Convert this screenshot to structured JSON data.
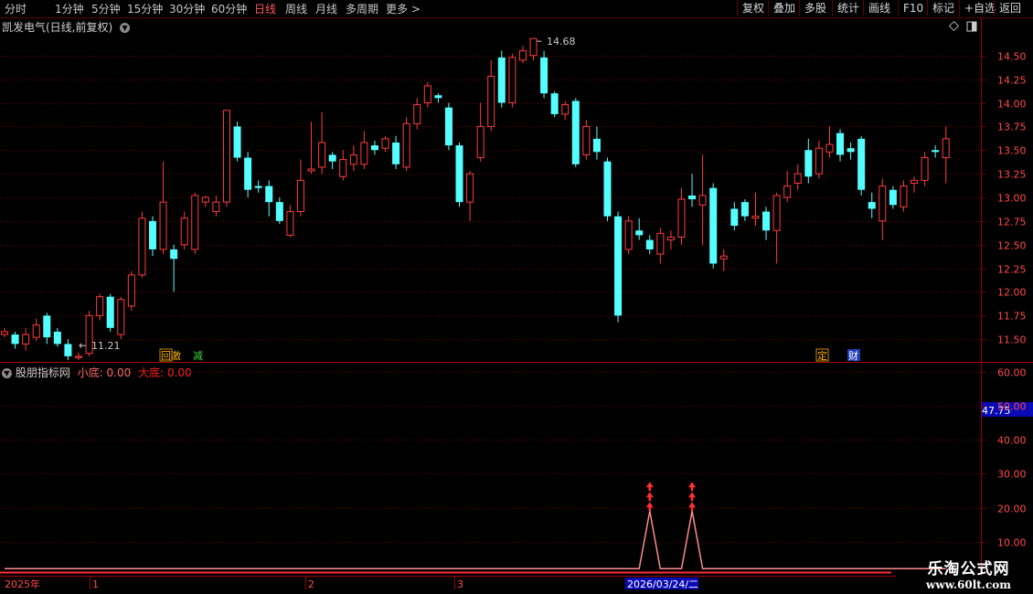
{
  "toolbar": {
    "periods": [
      "分时",
      "1分钟",
      "5分钟",
      "15分钟",
      "30分钟",
      "60分钟",
      "日线",
      "周线",
      "月线",
      "多周期",
      "更多 >"
    ],
    "active_period": "日线",
    "tools": [
      "复权",
      "叠加",
      "多股",
      "统计",
      "画线",
      "F10",
      "标记",
      "+自选",
      "返回"
    ]
  },
  "stock": {
    "title": "凯发电气(日线,前复权)"
  },
  "indicator": {
    "name": "股朋指标网",
    "small_label": "小底: ",
    "small_value": "0.00",
    "big_label": "大底: ",
    "big_value": "0.00",
    "current_readout": "47.75"
  },
  "price_labels": {
    "high": "14.68",
    "low": "11.21"
  },
  "event_tags": [
    "回",
    "激",
    "减",
    "定",
    "财"
  ],
  "time_axis": {
    "labels": [
      "2025年",
      "1",
      "2",
      "3"
    ],
    "cursor_date": "2026/03/24/二"
  },
  "watermark": {
    "site": "乐淘公式网",
    "url": "www.60lt.com"
  },
  "colors": {
    "up": "#ff3c3c",
    "down": "#54ffff",
    "grid": "#7a0000",
    "axis_text": "#ff4a4a",
    "signal": "#ff3030"
  },
  "chart_data": [
    {
      "type": "candlestick",
      "title": "凯发电气(日线,前复权)",
      "y_ticks": [
        "14.50",
        "14.25",
        "14.00",
        "13.75",
        "13.50",
        "13.25",
        "13.00",
        "12.75",
        "12.50",
        "12.25",
        "12.00",
        "11.75",
        "11.50"
      ],
      "ylim": [
        11.28,
        14.72
      ],
      "grid": true,
      "candles": [
        [
          11.55,
          11.58,
          11.52,
          11.62
        ],
        [
          11.55,
          11.45,
          11.4,
          11.58
        ],
        [
          11.45,
          11.55,
          11.38,
          11.62
        ],
        [
          11.52,
          11.65,
          11.48,
          11.72
        ],
        [
          11.75,
          11.52,
          11.45,
          11.78
        ],
        [
          11.58,
          11.45,
          11.42,
          11.62
        ],
        [
          11.45,
          11.32,
          11.28,
          11.5
        ],
        [
          11.32,
          11.32,
          11.28,
          11.36
        ],
        [
          11.35,
          11.75,
          11.32,
          11.8
        ],
        [
          11.75,
          11.95,
          11.7,
          11.98
        ],
        [
          11.95,
          11.62,
          11.58,
          11.98
        ],
        [
          11.55,
          11.92,
          11.5,
          11.95
        ],
        [
          11.85,
          12.18,
          11.8,
          12.22
        ],
        [
          12.18,
          12.78,
          12.15,
          12.85
        ],
        [
          12.75,
          12.45,
          12.38,
          12.8
        ],
        [
          12.45,
          12.95,
          12.4,
          13.38
        ],
        [
          12.45,
          12.35,
          12.0,
          12.5
        ],
        [
          12.5,
          12.78,
          12.45,
          12.85
        ],
        [
          12.45,
          13.02,
          12.4,
          13.05
        ],
        [
          12.95,
          13.0,
          12.9,
          13.02
        ],
        [
          12.85,
          12.95,
          12.8,
          13.02
        ],
        [
          12.95,
          13.92,
          12.9,
          13.85
        ],
        [
          13.75,
          13.42,
          13.38,
          13.8
        ],
        [
          13.42,
          13.08,
          13.0,
          13.48
        ],
        [
          13.12,
          13.1,
          13.05,
          13.18
        ],
        [
          13.12,
          12.95,
          12.8,
          13.18
        ],
        [
          12.95,
          12.75,
          12.72,
          13.0
        ],
        [
          12.6,
          12.85,
          12.58,
          12.92
        ],
        [
          12.85,
          13.18,
          12.8,
          13.4
        ],
        [
          13.28,
          13.3,
          13.25,
          13.8
        ],
        [
          13.32,
          13.58,
          13.25,
          13.9
        ],
        [
          13.45,
          13.38,
          13.3,
          13.48
        ],
        [
          13.22,
          13.4,
          13.18,
          13.5
        ],
        [
          13.35,
          13.45,
          13.28,
          13.55
        ],
        [
          13.35,
          13.58,
          13.3,
          13.7
        ],
        [
          13.55,
          13.5,
          13.45,
          13.6
        ],
        [
          13.52,
          13.62,
          13.48,
          13.65
        ],
        [
          13.58,
          13.35,
          13.3,
          13.65
        ],
        [
          13.32,
          13.78,
          13.28,
          13.85
        ],
        [
          13.78,
          13.98,
          13.72,
          14.05
        ],
        [
          14.0,
          14.18,
          13.95,
          14.22
        ],
        [
          14.08,
          14.05,
          14.0,
          14.1
        ],
        [
          13.95,
          13.55,
          13.5,
          14.0
        ],
        [
          13.55,
          12.95,
          12.9,
          13.58
        ],
        [
          12.95,
          13.25,
          12.75,
          13.28
        ],
        [
          13.42,
          13.75,
          13.38,
          14.0
        ],
        [
          13.75,
          14.28,
          13.7,
          14.45
        ],
        [
          14.48,
          14.0,
          13.95,
          14.55
        ],
        [
          14.0,
          14.48,
          13.95,
          14.52
        ],
        [
          14.45,
          14.55,
          14.42,
          14.6
        ],
        [
          14.5,
          14.68,
          14.45,
          14.68
        ],
        [
          14.48,
          14.1,
          14.05,
          14.55
        ],
        [
          14.1,
          13.88,
          13.85,
          14.12
        ],
        [
          13.88,
          13.98,
          13.82,
          14.02
        ],
        [
          14.02,
          13.35,
          13.32,
          14.05
        ],
        [
          13.45,
          13.75,
          13.4,
          13.82
        ],
        [
          13.62,
          13.48,
          13.4,
          13.75
        ],
        [
          13.38,
          12.8,
          12.75,
          13.42
        ],
        [
          12.8,
          11.75,
          11.68,
          12.85
        ],
        [
          12.45,
          12.75,
          12.4,
          12.8
        ],
        [
          12.65,
          12.6,
          12.55,
          12.78
        ],
        [
          12.55,
          12.45,
          12.4,
          12.6
        ],
        [
          12.4,
          12.62,
          12.3,
          12.68
        ],
        [
          12.55,
          12.58,
          12.45,
          12.65
        ],
        [
          12.58,
          12.98,
          12.5,
          13.1
        ],
        [
          13.02,
          12.98,
          12.9,
          13.25
        ],
        [
          12.92,
          13.02,
          12.5,
          13.45
        ],
        [
          13.1,
          12.3,
          12.25,
          13.15
        ],
        [
          12.35,
          12.38,
          12.22,
          12.45
        ],
        [
          12.88,
          12.7,
          12.65,
          12.95
        ],
        [
          12.95,
          12.8,
          12.75,
          12.98
        ],
        [
          12.78,
          12.8,
          12.7,
          13.05
        ],
        [
          12.85,
          12.65,
          12.55,
          12.9
        ],
        [
          12.65,
          13.02,
          12.3,
          13.05
        ],
        [
          13.0,
          13.12,
          12.95,
          13.28
        ],
        [
          13.15,
          13.25,
          13.08,
          13.35
        ],
        [
          13.5,
          13.22,
          13.15,
          13.62
        ],
        [
          13.25,
          13.52,
          13.2,
          13.6
        ],
        [
          13.48,
          13.56,
          13.42,
          13.75
        ],
        [
          13.68,
          13.45,
          13.38,
          13.72
        ],
        [
          13.52,
          13.48,
          13.4,
          13.58
        ],
        [
          13.62,
          13.08,
          13.02,
          13.65
        ],
        [
          12.95,
          12.88,
          12.78,
          13.05
        ],
        [
          12.75,
          13.12,
          12.55,
          13.2
        ],
        [
          13.08,
          12.92,
          12.88,
          13.12
        ],
        [
          12.9,
          13.12,
          12.85,
          13.18
        ],
        [
          13.15,
          13.18,
          13.05,
          13.22
        ],
        [
          13.18,
          13.42,
          13.12,
          13.48
        ],
        [
          13.5,
          13.48,
          13.42,
          13.55
        ],
        [
          13.42,
          13.62,
          13.15,
          13.75
        ]
      ]
    },
    {
      "type": "line",
      "title": "股朋指标网",
      "y_ticks": [
        "60.00",
        "50.00",
        "40.00",
        "30.00",
        "20.00",
        "10.00"
      ],
      "ylim": [
        1.0,
        63.0
      ],
      "signal_line": [
        2,
        2,
        2,
        2,
        2,
        2,
        2,
        2,
        2,
        2,
        2,
        2,
        2,
        2,
        2,
        2,
        2,
        2,
        2,
        2,
        2,
        2,
        2,
        2,
        2,
        2,
        2,
        2,
        2,
        2,
        2,
        2,
        2,
        2,
        2,
        2,
        2,
        2,
        2,
        2,
        2,
        2,
        2,
        2,
        2,
        2,
        2,
        2,
        2,
        2,
        2,
        2,
        2,
        2,
        2,
        2,
        2,
        2,
        2,
        2,
        2,
        19,
        2,
        2,
        2,
        19,
        2,
        2,
        2,
        2,
        2,
        2,
        2,
        2,
        2,
        2,
        2,
        2,
        2,
        2,
        2,
        2,
        2,
        2,
        2,
        2,
        2,
        2,
        2,
        2
      ],
      "arrow_signals": [
        61,
        65
      ]
    }
  ]
}
